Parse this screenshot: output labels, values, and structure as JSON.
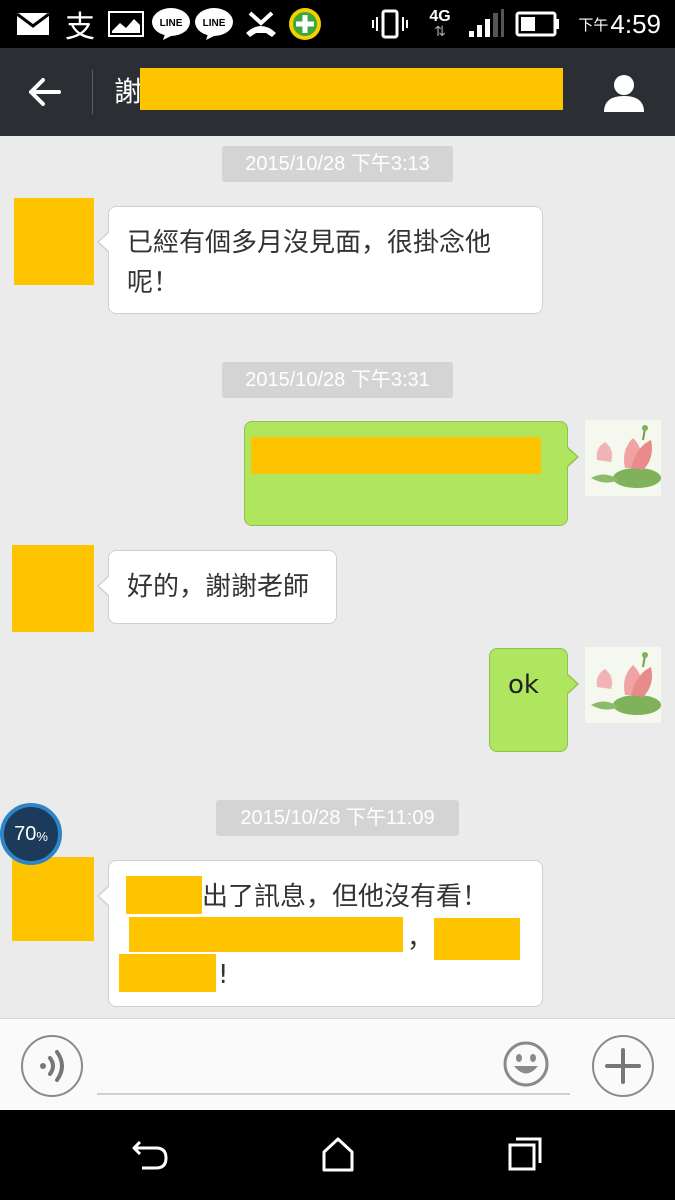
{
  "status_bar": {
    "time_prefix": "下午",
    "time": "4:59",
    "network": "4G",
    "notification_icons": [
      "gmail-icon",
      "alipay-icon",
      "gallery-icon",
      "line-icon",
      "line-icon",
      "missed-call-icon",
      "360-security-icon"
    ]
  },
  "header": {
    "back_icon": "arrow-left-icon",
    "title": "謝",
    "profile_icon": "person-icon"
  },
  "messages": {
    "ts1": "2015/10/28 下午3:13",
    "msg1_line1": "已經有個多月沒見面，很掛念他",
    "msg1_line2": "呢！",
    "ts2": "2015/10/28 下午3:31",
    "msg3": "好的，謝謝老師",
    "msg4": "ok",
    "ts3": "2015/10/28 下午11:09",
    "msg5_line1": "出了訊息，但他沒有看！",
    "msg5_comma": "，",
    "msg5_end": "!"
  },
  "float_badge": {
    "value": "70",
    "unit": "%"
  },
  "input_bar": {
    "placeholder": "",
    "voice_icon": "voice-wave-icon",
    "emoji_icon": "smiley-icon",
    "plus_icon": "plus-icon"
  },
  "colors": {
    "header_bg": "#2b2f33",
    "chat_bg": "#ebebeb",
    "outgoing_bubble": "#b0e55f",
    "incoming_bubble": "#ffffff",
    "redaction": "#ffc400"
  }
}
